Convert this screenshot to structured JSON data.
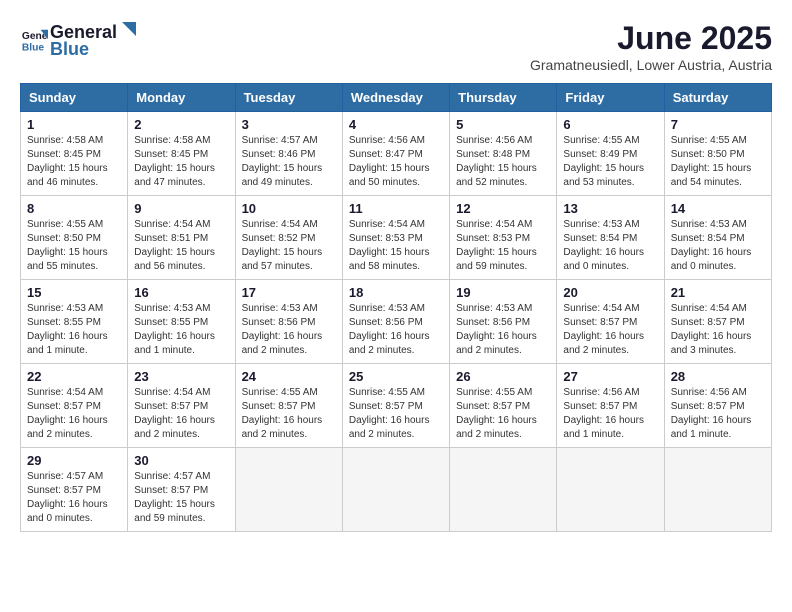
{
  "header": {
    "logo_line1": "General",
    "logo_line2": "Blue",
    "month": "June 2025",
    "location": "Gramatneusiedl, Lower Austria, Austria"
  },
  "weekdays": [
    "Sunday",
    "Monday",
    "Tuesday",
    "Wednesday",
    "Thursday",
    "Friday",
    "Saturday"
  ],
  "weeks": [
    [
      {
        "day": "1",
        "sunrise": "4:58 AM",
        "sunset": "8:45 PM",
        "daylight": "15 hours and 46 minutes."
      },
      {
        "day": "2",
        "sunrise": "4:58 AM",
        "sunset": "8:45 PM",
        "daylight": "15 hours and 47 minutes."
      },
      {
        "day": "3",
        "sunrise": "4:57 AM",
        "sunset": "8:46 PM",
        "daylight": "15 hours and 49 minutes."
      },
      {
        "day": "4",
        "sunrise": "4:56 AM",
        "sunset": "8:47 PM",
        "daylight": "15 hours and 50 minutes."
      },
      {
        "day": "5",
        "sunrise": "4:56 AM",
        "sunset": "8:48 PM",
        "daylight": "15 hours and 52 minutes."
      },
      {
        "day": "6",
        "sunrise": "4:55 AM",
        "sunset": "8:49 PM",
        "daylight": "15 hours and 53 minutes."
      },
      {
        "day": "7",
        "sunrise": "4:55 AM",
        "sunset": "8:50 PM",
        "daylight": "15 hours and 54 minutes."
      }
    ],
    [
      {
        "day": "8",
        "sunrise": "4:55 AM",
        "sunset": "8:50 PM",
        "daylight": "15 hours and 55 minutes."
      },
      {
        "day": "9",
        "sunrise": "4:54 AM",
        "sunset": "8:51 PM",
        "daylight": "15 hours and 56 minutes."
      },
      {
        "day": "10",
        "sunrise": "4:54 AM",
        "sunset": "8:52 PM",
        "daylight": "15 hours and 57 minutes."
      },
      {
        "day": "11",
        "sunrise": "4:54 AM",
        "sunset": "8:53 PM",
        "daylight": "15 hours and 58 minutes."
      },
      {
        "day": "12",
        "sunrise": "4:54 AM",
        "sunset": "8:53 PM",
        "daylight": "15 hours and 59 minutes."
      },
      {
        "day": "13",
        "sunrise": "4:53 AM",
        "sunset": "8:54 PM",
        "daylight": "16 hours and 0 minutes."
      },
      {
        "day": "14",
        "sunrise": "4:53 AM",
        "sunset": "8:54 PM",
        "daylight": "16 hours and 0 minutes."
      }
    ],
    [
      {
        "day": "15",
        "sunrise": "4:53 AM",
        "sunset": "8:55 PM",
        "daylight": "16 hours and 1 minute."
      },
      {
        "day": "16",
        "sunrise": "4:53 AM",
        "sunset": "8:55 PM",
        "daylight": "16 hours and 1 minute."
      },
      {
        "day": "17",
        "sunrise": "4:53 AM",
        "sunset": "8:56 PM",
        "daylight": "16 hours and 2 minutes."
      },
      {
        "day": "18",
        "sunrise": "4:53 AM",
        "sunset": "8:56 PM",
        "daylight": "16 hours and 2 minutes."
      },
      {
        "day": "19",
        "sunrise": "4:53 AM",
        "sunset": "8:56 PM",
        "daylight": "16 hours and 2 minutes."
      },
      {
        "day": "20",
        "sunrise": "4:54 AM",
        "sunset": "8:57 PM",
        "daylight": "16 hours and 2 minutes."
      },
      {
        "day": "21",
        "sunrise": "4:54 AM",
        "sunset": "8:57 PM",
        "daylight": "16 hours and 3 minutes."
      }
    ],
    [
      {
        "day": "22",
        "sunrise": "4:54 AM",
        "sunset": "8:57 PM",
        "daylight": "16 hours and 2 minutes."
      },
      {
        "day": "23",
        "sunrise": "4:54 AM",
        "sunset": "8:57 PM",
        "daylight": "16 hours and 2 minutes."
      },
      {
        "day": "24",
        "sunrise": "4:55 AM",
        "sunset": "8:57 PM",
        "daylight": "16 hours and 2 minutes."
      },
      {
        "day": "25",
        "sunrise": "4:55 AM",
        "sunset": "8:57 PM",
        "daylight": "16 hours and 2 minutes."
      },
      {
        "day": "26",
        "sunrise": "4:55 AM",
        "sunset": "8:57 PM",
        "daylight": "16 hours and 2 minutes."
      },
      {
        "day": "27",
        "sunrise": "4:56 AM",
        "sunset": "8:57 PM",
        "daylight": "16 hours and 1 minute."
      },
      {
        "day": "28",
        "sunrise": "4:56 AM",
        "sunset": "8:57 PM",
        "daylight": "16 hours and 1 minute."
      }
    ],
    [
      {
        "day": "29",
        "sunrise": "4:57 AM",
        "sunset": "8:57 PM",
        "daylight": "16 hours and 0 minutes."
      },
      {
        "day": "30",
        "sunrise": "4:57 AM",
        "sunset": "8:57 PM",
        "daylight": "15 hours and 59 minutes."
      },
      null,
      null,
      null,
      null,
      null
    ]
  ]
}
